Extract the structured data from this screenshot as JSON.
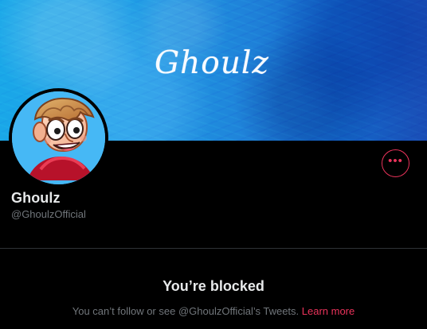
{
  "banner": {
    "title": "Ghoulz"
  },
  "profile": {
    "display_name": "Ghoulz",
    "username": "@GhoulzOfficial",
    "avatar_icon": "cartoon-boy-avatar",
    "more_icon": "more-options-icon"
  },
  "blocked": {
    "title": "You’re blocked",
    "message_prefix": "You can’t follow or see @GhoulzOfficial’s Tweets. ",
    "learn_more": "Learn more"
  },
  "colors": {
    "background": "#000000",
    "accent": "#ea335b",
    "text_primary": "#e7e9ea",
    "text_secondary": "#71767b",
    "banner_blue": "#1f82d9"
  }
}
